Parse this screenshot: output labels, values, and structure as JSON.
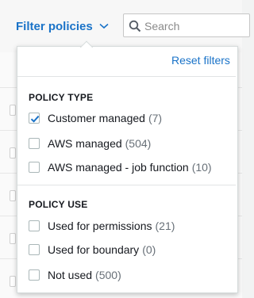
{
  "toolbar": {
    "filter_label": "Filter policies",
    "search_placeholder": "Search"
  },
  "dropdown": {
    "reset_label": "Reset filters",
    "sections": [
      {
        "title": "POLICY TYPE",
        "options": [
          {
            "label": "Customer managed",
            "count": "(7)",
            "checked": true
          },
          {
            "label": "AWS managed",
            "count": "(504)",
            "checked": false
          },
          {
            "label": "AWS managed - job function",
            "count": "(10)",
            "checked": false
          }
        ]
      },
      {
        "title": "POLICY USE",
        "options": [
          {
            "label": "Used for permissions",
            "count": "(21)",
            "checked": false
          },
          {
            "label": "Used for boundary",
            "count": "(0)",
            "checked": false
          },
          {
            "label": "Not used",
            "count": "(500)",
            "checked": false
          }
        ]
      }
    ]
  },
  "background_fragments": [
    "to",
    "to",
    "i"
  ],
  "colors": {
    "accent": "#1a73c8",
    "check": "#1a73c8",
    "muted": "#687078"
  }
}
